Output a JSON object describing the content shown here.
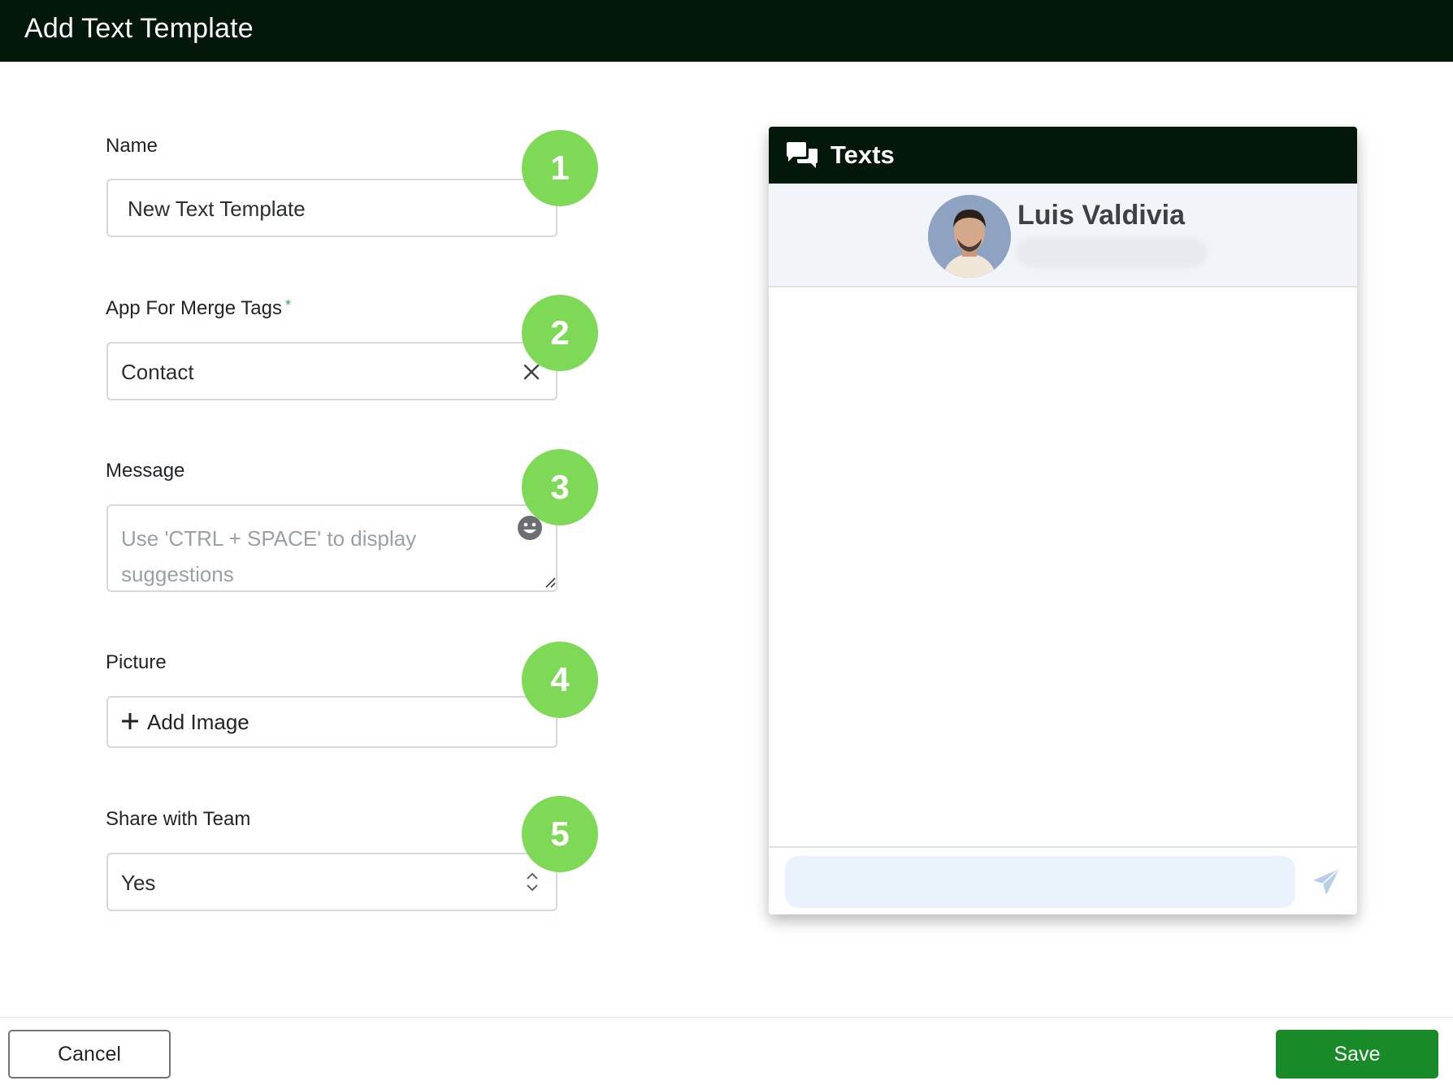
{
  "header": {
    "title": "Add Text Template"
  },
  "form": {
    "name": {
      "label": "Name",
      "value": "New Text Template"
    },
    "app_merge_tags": {
      "label": "App For Merge Tags",
      "required_mark": "*",
      "value": "Contact"
    },
    "message": {
      "label": "Message",
      "placeholder": "Use 'CTRL + SPACE' to display suggestions"
    },
    "picture": {
      "label": "Picture",
      "button_label": "Add Image"
    },
    "share": {
      "label": "Share with Team",
      "value": "Yes"
    }
  },
  "badges": [
    "1",
    "2",
    "3",
    "4",
    "5"
  ],
  "preview": {
    "title": "Texts",
    "contact_name": "Luis Valdivia"
  },
  "footer": {
    "cancel_label": "Cancel",
    "save_label": "Save"
  },
  "colors": {
    "header_bg": "#03170a",
    "badge": "#7ed957",
    "save": "#188a28",
    "required": "#2fb344"
  },
  "icons": [
    "clear-icon",
    "emoji-icon",
    "resize-handle-icon",
    "plus-icon",
    "chevron-updown-icon",
    "chat-bubbles-icon",
    "send-icon"
  ]
}
